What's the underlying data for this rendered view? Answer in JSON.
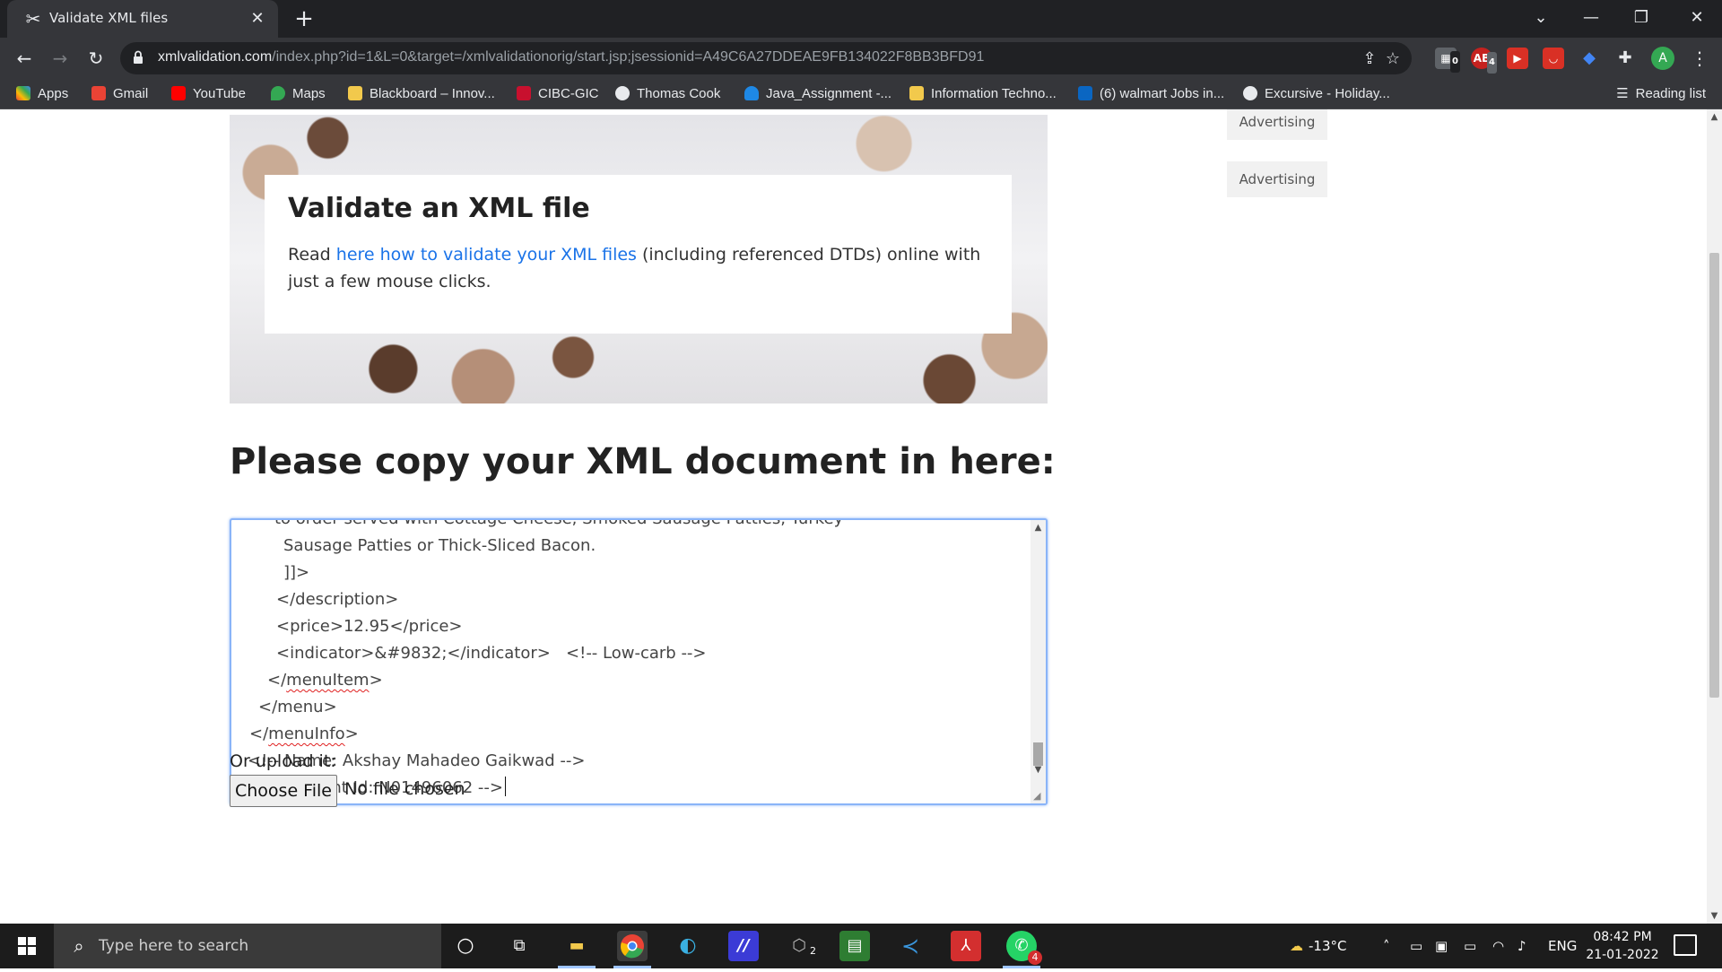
{
  "browser": {
    "tab_title": "Validate XML files",
    "tab_close": "✕",
    "new_tab": "+",
    "url_host": "xmlvalidation.com",
    "url_path": "/index.php?id=1&L=0&target=/xmlvalidationorig/start.jsp;jsessionid=A49C6A27DDEAE9FB134022F8BB3BFD91",
    "extension_badges": {
      "first": "0",
      "abp": "4"
    },
    "avatar_letter": "A",
    "bookmarks": [
      {
        "label": "Apps",
        "color": "#ea4335"
      },
      {
        "label": "Gmail",
        "color": "#ea4335"
      },
      {
        "label": "YouTube",
        "color": "#ff0000"
      },
      {
        "label": "Maps",
        "color": "#34a853"
      },
      {
        "label": "Blackboard – Innov...",
        "color": "#f2c94c"
      },
      {
        "label": "CIBC-GIC",
        "color": "#c8102e"
      },
      {
        "label": "Thomas Cook",
        "color": "#e8eaed"
      },
      {
        "label": "Java_Assignment -...",
        "color": "#1e88e5"
      },
      {
        "label": "Information Techno...",
        "color": "#f2c94c"
      },
      {
        "label": "(6) walmart Jobs in...",
        "color": "#0a66c2"
      },
      {
        "label": "Excursive - Holiday...",
        "color": "#e8eaed"
      }
    ],
    "reading_list": "Reading list"
  },
  "page": {
    "card_title": "Validate an XML file",
    "card_text_before": "Read ",
    "card_link": "here how to validate your XML files",
    "card_text_after": " (including referenced DTDs) online with just a few mouse clicks.",
    "ads": [
      "Advertising",
      "Advertising"
    ],
    "heading": "Please copy your XML document in here:",
    "editor_lines": [
      {
        "indent": 48,
        "text": "to order served with Cottage Cheese, Smoked Sausage Patties, Turkey"
      },
      {
        "indent": 48,
        "text": "Sausage Patties or Thick-Sliced Bacon."
      },
      {
        "indent": 48,
        "text": "]]>"
      },
      {
        "indent": 40,
        "text": "</description>"
      },
      {
        "indent": 40,
        "text": "<price>12.95</price>"
      },
      {
        "indent": 40,
        "text": "<indicator>&#9832;</indicator>   <!-- Low-carb -->"
      },
      {
        "indent": 30,
        "pre": "</",
        "word": "menuItem",
        "post": ">"
      },
      {
        "indent": 20,
        "text": "</menu>"
      },
      {
        "indent": 10,
        "pre": "</",
        "word": "menuInfo",
        "post": ">"
      },
      {
        "indent": 10,
        "text": "<!-- Name: Akshay Mahadeo Gaikwad -->"
      },
      {
        "indent": 10,
        "text": "<!-- Student Id: N01496062 -->"
      }
    ],
    "upload_label": "Or upload it:",
    "choose_file": "Choose File",
    "no_file": "No file chosen"
  },
  "taskbar": {
    "search_placeholder": "Type here to search",
    "weather": "-13°C",
    "language": "ENG",
    "time": "08:42 PM",
    "date": "21-01-2022",
    "badges": {
      "taskview": "2",
      "whatsapp": "4"
    }
  }
}
